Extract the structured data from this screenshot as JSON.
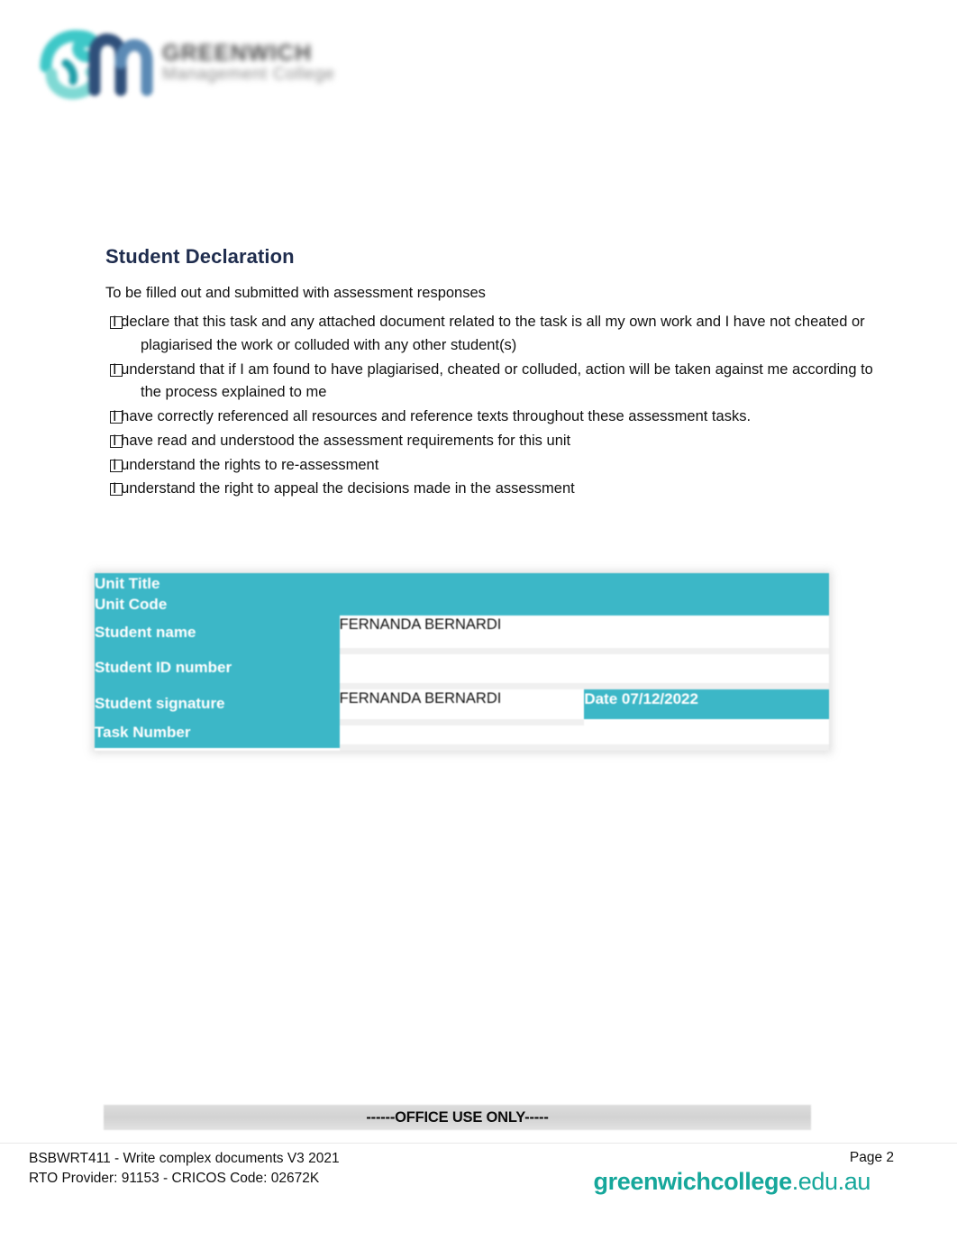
{
  "header": {
    "logo_mark": "greenwich-gm-monogram",
    "logo_line1": "GREENWICH",
    "logo_line2": "Management College"
  },
  "declaration": {
    "title": "Student Declaration",
    "intro": "To be filled out and submitted with assessment responses",
    "checkbox_glyph": "empty-square",
    "items": [
      "I declare that this task and any attached document related to the task is all my own work and I have not cheated or plagiarised the work or colluded with any other student(s)",
      "I understand that if I am found to have plagiarised, cheated or colluded, action will be taken against me according to the process explained to me",
      "I have correctly referenced all resources and reference texts throughout these assessment tasks.",
      "I have read and understood the assessment requirements for this unit",
      "I understand the rights to re-assessment",
      "I understand the right to appeal the decisions made in the assessment"
    ]
  },
  "details_table": {
    "rows": [
      {
        "label": "Unit Title",
        "value": "",
        "date": "",
        "full_width_label": true,
        "has_date_cell": false
      },
      {
        "label": "Unit Code",
        "value": "",
        "date": "",
        "full_width_label": true,
        "has_date_cell": false
      },
      {
        "label": "Student name",
        "value": "FERNANDA BERNARDI",
        "date": "",
        "full_width_label": false,
        "has_date_cell": false
      },
      {
        "label": "Student ID number",
        "value": "",
        "date": "",
        "full_width_label": false,
        "has_date_cell": false
      },
      {
        "label": "Student signature",
        "value": "FERNANDA BERNARDI",
        "date": "Date 07/12/2022",
        "full_width_label": false,
        "has_date_cell": true
      },
      {
        "label": "Task Number",
        "value": "",
        "date": "",
        "full_width_label": false,
        "has_date_cell": true
      }
    ]
  },
  "office_use": {
    "banner": "------OFFICE USE ONLY-----"
  },
  "footer": {
    "line1": "BSBWRT411 - Write complex documents V3 2021",
    "line2": "RTO Provider: 91153  - CRICOS  Code: 02672K",
    "page": "Page 2",
    "url_bold": "greenwichcollege",
    "url_light": ".edu.au"
  },
  "colors": {
    "teal": "#3CB7C7",
    "navy": "#1F2D4E",
    "footer_teal": "#16A79B",
    "office_bar_gray": "#D8D8D8"
  }
}
